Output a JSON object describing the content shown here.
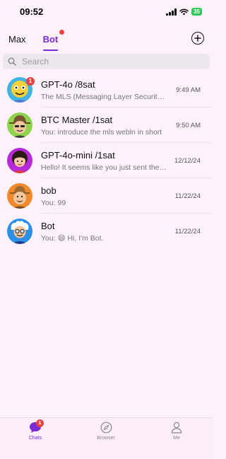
{
  "status_bar": {
    "time": "09:52",
    "battery": "35"
  },
  "tabs": [
    {
      "label": "Max",
      "active": false
    },
    {
      "label": "Bot",
      "active": true,
      "has_dot": true
    }
  ],
  "search": {
    "placeholder": "Search",
    "value": ""
  },
  "chats": [
    {
      "name": "GPT-4o /8sat",
      "preview": "The MLS (Messaging Layer Security) protocol",
      "time": "9:49 AM",
      "unread": "1",
      "avatar": "yellow-robot-avatar"
    },
    {
      "name": "BTC Master /1sat",
      "preview": "You: introduce the mls webln in short",
      "time": "9:50 AM",
      "avatar": "hat-man-avatar"
    },
    {
      "name": "GPT-4o-mini /1sat",
      "preview": "Hello! It seems like you just sent the word",
      "time": "12/12/24",
      "avatar": "red-hair-avatar"
    },
    {
      "name": "bob",
      "preview": "You: 99",
      "time": "11/22/24",
      "avatar": "cowboy-avatar"
    },
    {
      "name": "Bot",
      "preview_prefix": "You:",
      "preview_emoji": "😄",
      "preview_text": "Hi, I'm Bot.",
      "time": "11/22/24",
      "avatar": "white-hair-glasses-avatar"
    }
  ],
  "bottom_nav": [
    {
      "label": "Chats",
      "active": true,
      "badge": "1"
    },
    {
      "label": "Browser",
      "active": false
    },
    {
      "label": "Me",
      "active": false
    }
  ],
  "colors": {
    "accent": "#7b2ad6",
    "badge": "#ec4242",
    "background": "#fdf1fb"
  }
}
